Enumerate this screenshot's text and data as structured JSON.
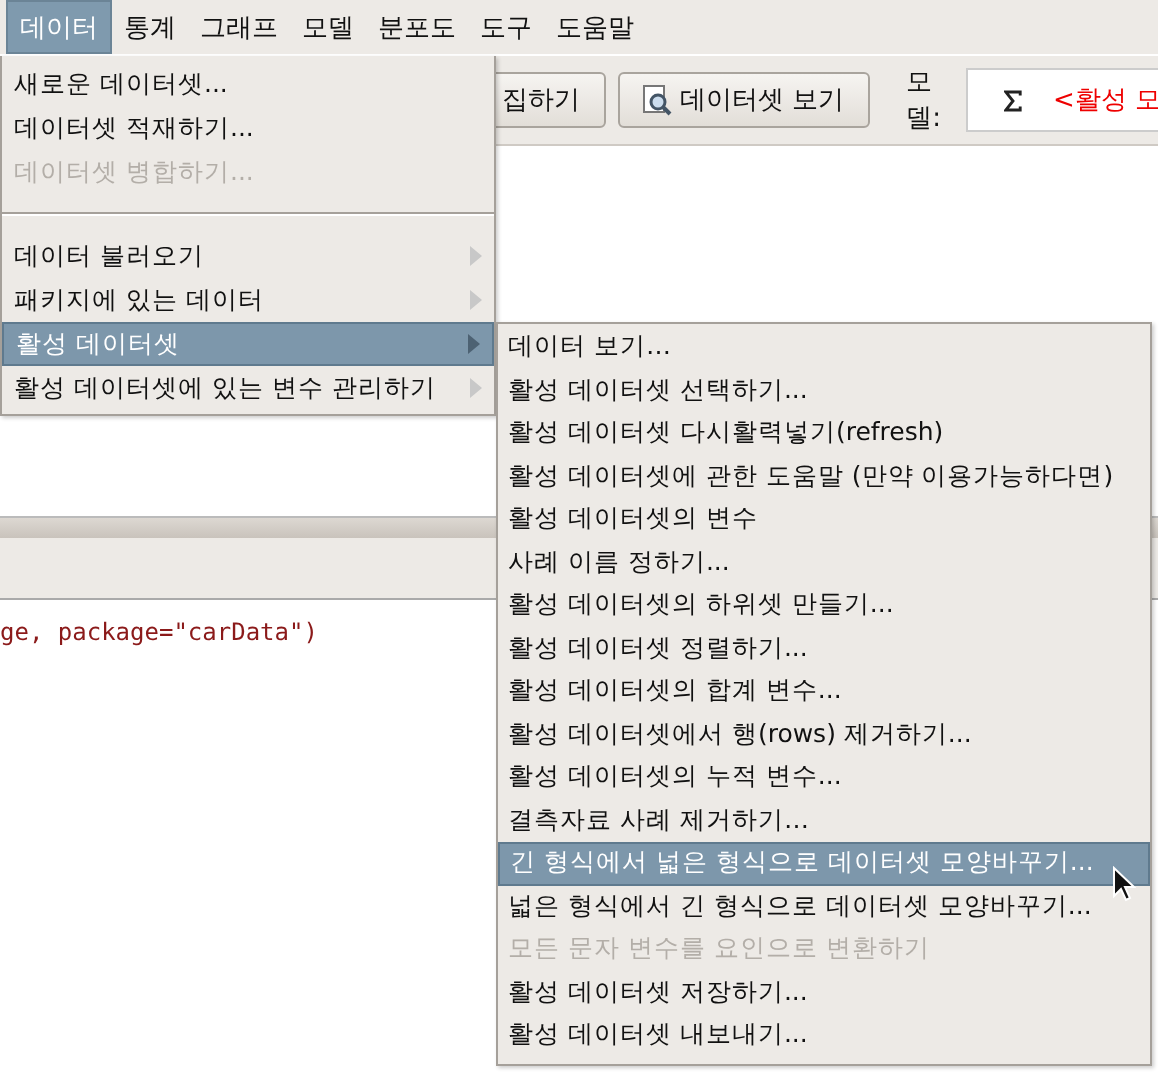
{
  "menubar": [
    {
      "label": "데이터",
      "selected": true
    },
    {
      "label": "통계",
      "selected": false
    },
    {
      "label": "그래프",
      "selected": false
    },
    {
      "label": "모델",
      "selected": false
    },
    {
      "label": "분포도",
      "selected": false
    },
    {
      "label": "도구",
      "selected": false
    },
    {
      "label": "도움말",
      "selected": false
    }
  ],
  "toolbar": {
    "buttons": [
      {
        "label": "집하기",
        "kind": "plain"
      },
      {
        "label": "데이터셋 보기",
        "kind": "view"
      }
    ],
    "model_label": "모델:",
    "model_value": "<활성 모"
  },
  "script_text": "ge, package=\"carData\")",
  "menu": [
    {
      "kind": "item",
      "label": "새로운 데이터셋...",
      "disabled": false,
      "selected": false,
      "submenu": false
    },
    {
      "kind": "item",
      "label": "데이터셋 적재하기...",
      "disabled": false,
      "selected": false,
      "submenu": false
    },
    {
      "kind": "item",
      "label": "데이터셋 병합하기...",
      "disabled": true,
      "selected": false,
      "submenu": false
    },
    {
      "kind": "separator"
    },
    {
      "kind": "item",
      "label": "데이터 불러오기",
      "disabled": false,
      "selected": false,
      "submenu": true
    },
    {
      "kind": "item",
      "label": "패키지에 있는 데이터",
      "disabled": false,
      "selected": false,
      "submenu": true
    },
    {
      "kind": "item",
      "label": "활성 데이터셋",
      "disabled": false,
      "selected": true,
      "submenu": true
    },
    {
      "kind": "item",
      "label": "활성 데이터셋에 있는 변수 관리하기",
      "disabled": false,
      "selected": false,
      "submenu": true
    }
  ],
  "submenu": [
    {
      "label": "데이터 보기…",
      "disabled": false,
      "selected": false
    },
    {
      "label": "활성 데이터셋 선택하기...",
      "disabled": false,
      "selected": false
    },
    {
      "label": "활성 데이터셋 다시활력넣기(refresh)",
      "disabled": false,
      "selected": false
    },
    {
      "label": "활성 데이터셋에 관한 도움말 (만약 이용가능하다면)",
      "disabled": false,
      "selected": false
    },
    {
      "label": "활성 데이터셋의 변수",
      "disabled": false,
      "selected": false
    },
    {
      "label": "사례 이름 정하기...",
      "disabled": false,
      "selected": false
    },
    {
      "label": "활성 데이터셋의 하위셋 만들기...",
      "disabled": false,
      "selected": false
    },
    {
      "label": "활성 데이터셋 정렬하기...",
      "disabled": false,
      "selected": false
    },
    {
      "label": "활성 데이터셋의 합계 변수...",
      "disabled": false,
      "selected": false
    },
    {
      "label": "활성 데이터셋에서 행(rows) 제거하기...",
      "disabled": false,
      "selected": false
    },
    {
      "label": "활성 데이터셋의 누적 변수...",
      "disabled": false,
      "selected": false
    },
    {
      "label": "결측자료 사례 제거하기…",
      "disabled": false,
      "selected": false
    },
    {
      "label": "긴 형식에서 넓은 형식으로 데이터셋 모양바꾸기...",
      "disabled": false,
      "selected": true
    },
    {
      "label": "넓은 형식에서 긴 형식으로 데이터셋 모양바꾸기...",
      "disabled": false,
      "selected": false
    },
    {
      "label": "모든 문자 변수를 요인으로 변환하기",
      "disabled": true,
      "selected": false
    },
    {
      "label": "활성 데이터셋 저장하기...",
      "disabled": false,
      "selected": false
    },
    {
      "label": "활성 데이터셋 내보내기...",
      "disabled": false,
      "selected": false
    }
  ]
}
